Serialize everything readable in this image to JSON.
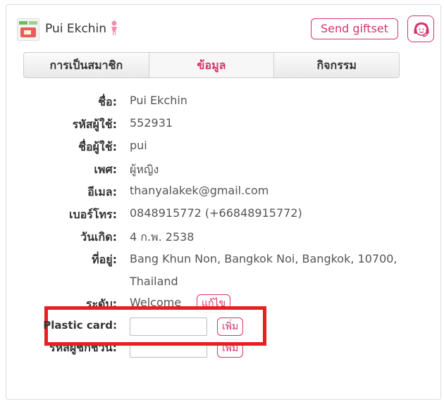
{
  "header": {
    "username": "Pui  Ekchin",
    "send_giftset_label": "Send giftset",
    "gender_icon": "female-icon",
    "support_icon": "headset-support-icon"
  },
  "tabs": [
    {
      "label": "การเป็นสมาชิก"
    },
    {
      "label": "ข้อมูล",
      "active": true
    },
    {
      "label": "กิจกรรม"
    }
  ],
  "profile": {
    "name_label": "ชื่อ:",
    "name_value": "Pui  Ekchin",
    "user_id_label": "รหัสผู้ใช้:",
    "user_id_value": "552931",
    "username_label": "ชื่อผู้ใช้:",
    "username_value": "pui",
    "gender_label": "เพศ:",
    "gender_value": "ผู้หญิง",
    "email_label": "อีเมล:",
    "email_value": "thanyalakek@gmail.com",
    "phone_label": "เบอร์โทร:",
    "phone_value": "0848915772 (+66848915772)",
    "birthday_label": "วันเกิด:",
    "birthday_value": "4  ก.พ.  2538",
    "address_label": "ที่อยู่:",
    "address_value": "Bang  Khun  Non,  Bangkok  Noi,  Bangkok,  10700,  Thailand",
    "level_label": "ระดับ:",
    "level_value": "Welcome",
    "level_edit_label": "แก้ไข",
    "plastic_card_label": "Plastic card:",
    "plastic_card_value": "",
    "plastic_card_add_label": "เพิ่ม",
    "referral_label": "รหัสผู้ชักชวน:",
    "referral_value": "",
    "referral_add_label": "เพิ่ม"
  },
  "colors": {
    "accent": "#d6336c",
    "highlight_box": "#e62020"
  }
}
